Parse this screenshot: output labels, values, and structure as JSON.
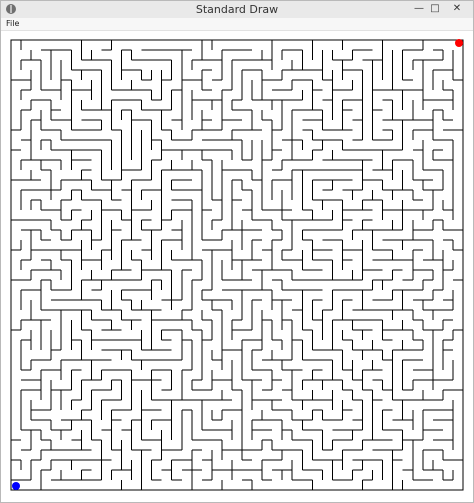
{
  "window": {
    "title": "Standard Draw",
    "menu": {
      "file_label": "File"
    },
    "controls": {
      "minimize_symbol": "—",
      "maximize_symbol": "□",
      "close_symbol": "✕"
    }
  },
  "maze": {
    "description": "rendered grid maze",
    "start_color": "#0000ff",
    "end_color": "#ff0000",
    "wall_color": "#000000",
    "background_color": "#ffffff"
  },
  "icons": {
    "app": "java-app-icon",
    "minimize": "minimize-icon",
    "maximize": "maximize-icon",
    "close": "close-icon",
    "start": "start-dot-icon",
    "goal": "goal-dot-icon"
  }
}
